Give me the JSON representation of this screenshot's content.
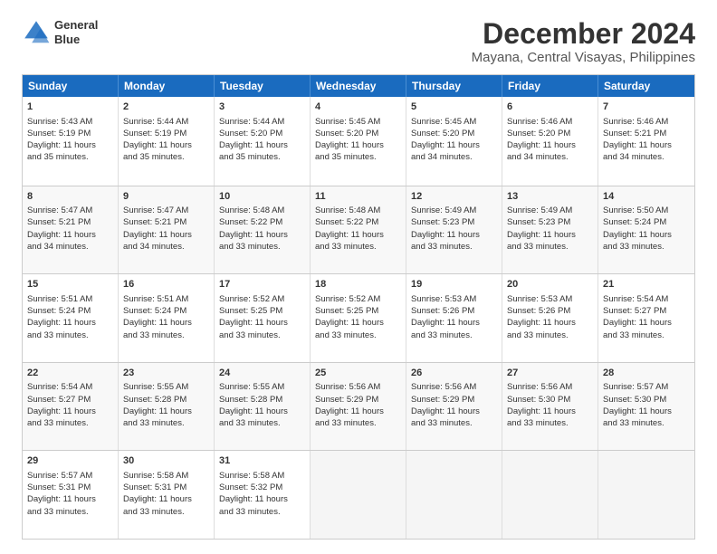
{
  "logo": {
    "line1": "General",
    "line2": "Blue"
  },
  "title": "December 2024",
  "subtitle": "Mayana, Central Visayas, Philippines",
  "header_days": [
    "Sunday",
    "Monday",
    "Tuesday",
    "Wednesday",
    "Thursday",
    "Friday",
    "Saturday"
  ],
  "rows": [
    [
      {
        "day": "1",
        "lines": [
          "Sunrise: 5:43 AM",
          "Sunset: 5:19 PM",
          "Daylight: 11 hours",
          "and 35 minutes."
        ]
      },
      {
        "day": "2",
        "lines": [
          "Sunrise: 5:44 AM",
          "Sunset: 5:19 PM",
          "Daylight: 11 hours",
          "and 35 minutes."
        ]
      },
      {
        "day": "3",
        "lines": [
          "Sunrise: 5:44 AM",
          "Sunset: 5:20 PM",
          "Daylight: 11 hours",
          "and 35 minutes."
        ]
      },
      {
        "day": "4",
        "lines": [
          "Sunrise: 5:45 AM",
          "Sunset: 5:20 PM",
          "Daylight: 11 hours",
          "and 35 minutes."
        ]
      },
      {
        "day": "5",
        "lines": [
          "Sunrise: 5:45 AM",
          "Sunset: 5:20 PM",
          "Daylight: 11 hours",
          "and 34 minutes."
        ]
      },
      {
        "day": "6",
        "lines": [
          "Sunrise: 5:46 AM",
          "Sunset: 5:20 PM",
          "Daylight: 11 hours",
          "and 34 minutes."
        ]
      },
      {
        "day": "7",
        "lines": [
          "Sunrise: 5:46 AM",
          "Sunset: 5:21 PM",
          "Daylight: 11 hours",
          "and 34 minutes."
        ]
      }
    ],
    [
      {
        "day": "8",
        "lines": [
          "Sunrise: 5:47 AM",
          "Sunset: 5:21 PM",
          "Daylight: 11 hours",
          "and 34 minutes."
        ]
      },
      {
        "day": "9",
        "lines": [
          "Sunrise: 5:47 AM",
          "Sunset: 5:21 PM",
          "Daylight: 11 hours",
          "and 34 minutes."
        ]
      },
      {
        "day": "10",
        "lines": [
          "Sunrise: 5:48 AM",
          "Sunset: 5:22 PM",
          "Daylight: 11 hours",
          "and 33 minutes."
        ]
      },
      {
        "day": "11",
        "lines": [
          "Sunrise: 5:48 AM",
          "Sunset: 5:22 PM",
          "Daylight: 11 hours",
          "and 33 minutes."
        ]
      },
      {
        "day": "12",
        "lines": [
          "Sunrise: 5:49 AM",
          "Sunset: 5:23 PM",
          "Daylight: 11 hours",
          "and 33 minutes."
        ]
      },
      {
        "day": "13",
        "lines": [
          "Sunrise: 5:49 AM",
          "Sunset: 5:23 PM",
          "Daylight: 11 hours",
          "and 33 minutes."
        ]
      },
      {
        "day": "14",
        "lines": [
          "Sunrise: 5:50 AM",
          "Sunset: 5:24 PM",
          "Daylight: 11 hours",
          "and 33 minutes."
        ]
      }
    ],
    [
      {
        "day": "15",
        "lines": [
          "Sunrise: 5:51 AM",
          "Sunset: 5:24 PM",
          "Daylight: 11 hours",
          "and 33 minutes."
        ]
      },
      {
        "day": "16",
        "lines": [
          "Sunrise: 5:51 AM",
          "Sunset: 5:24 PM",
          "Daylight: 11 hours",
          "and 33 minutes."
        ]
      },
      {
        "day": "17",
        "lines": [
          "Sunrise: 5:52 AM",
          "Sunset: 5:25 PM",
          "Daylight: 11 hours",
          "and 33 minutes."
        ]
      },
      {
        "day": "18",
        "lines": [
          "Sunrise: 5:52 AM",
          "Sunset: 5:25 PM",
          "Daylight: 11 hours",
          "and 33 minutes."
        ]
      },
      {
        "day": "19",
        "lines": [
          "Sunrise: 5:53 AM",
          "Sunset: 5:26 PM",
          "Daylight: 11 hours",
          "and 33 minutes."
        ]
      },
      {
        "day": "20",
        "lines": [
          "Sunrise: 5:53 AM",
          "Sunset: 5:26 PM",
          "Daylight: 11 hours",
          "and 33 minutes."
        ]
      },
      {
        "day": "21",
        "lines": [
          "Sunrise: 5:54 AM",
          "Sunset: 5:27 PM",
          "Daylight: 11 hours",
          "and 33 minutes."
        ]
      }
    ],
    [
      {
        "day": "22",
        "lines": [
          "Sunrise: 5:54 AM",
          "Sunset: 5:27 PM",
          "Daylight: 11 hours",
          "and 33 minutes."
        ]
      },
      {
        "day": "23",
        "lines": [
          "Sunrise: 5:55 AM",
          "Sunset: 5:28 PM",
          "Daylight: 11 hours",
          "and 33 minutes."
        ]
      },
      {
        "day": "24",
        "lines": [
          "Sunrise: 5:55 AM",
          "Sunset: 5:28 PM",
          "Daylight: 11 hours",
          "and 33 minutes."
        ]
      },
      {
        "day": "25",
        "lines": [
          "Sunrise: 5:56 AM",
          "Sunset: 5:29 PM",
          "Daylight: 11 hours",
          "and 33 minutes."
        ]
      },
      {
        "day": "26",
        "lines": [
          "Sunrise: 5:56 AM",
          "Sunset: 5:29 PM",
          "Daylight: 11 hours",
          "and 33 minutes."
        ]
      },
      {
        "day": "27",
        "lines": [
          "Sunrise: 5:56 AM",
          "Sunset: 5:30 PM",
          "Daylight: 11 hours",
          "and 33 minutes."
        ]
      },
      {
        "day": "28",
        "lines": [
          "Sunrise: 5:57 AM",
          "Sunset: 5:30 PM",
          "Daylight: 11 hours",
          "and 33 minutes."
        ]
      }
    ],
    [
      {
        "day": "29",
        "lines": [
          "Sunrise: 5:57 AM",
          "Sunset: 5:31 PM",
          "Daylight: 11 hours",
          "and 33 minutes."
        ]
      },
      {
        "day": "30",
        "lines": [
          "Sunrise: 5:58 AM",
          "Sunset: 5:31 PM",
          "Daylight: 11 hours",
          "and 33 minutes."
        ]
      },
      {
        "day": "31",
        "lines": [
          "Sunrise: 5:58 AM",
          "Sunset: 5:32 PM",
          "Daylight: 11 hours",
          "and 33 minutes."
        ]
      },
      {
        "day": "",
        "lines": []
      },
      {
        "day": "",
        "lines": []
      },
      {
        "day": "",
        "lines": []
      },
      {
        "day": "",
        "lines": []
      }
    ]
  ]
}
